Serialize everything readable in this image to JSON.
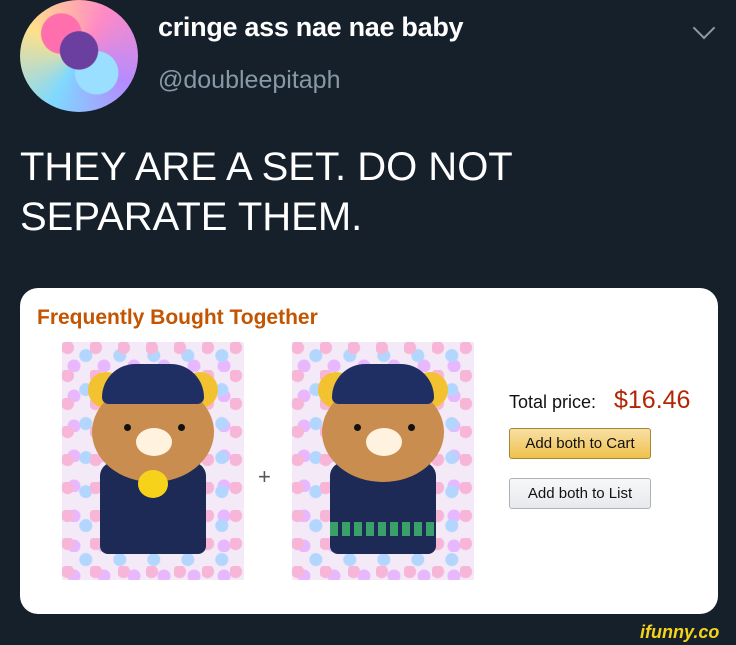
{
  "tweet": {
    "display_name": "cringe ass nae nae baby",
    "handle": "@doubleepitaph",
    "text": "THEY ARE A SET. DO NOT SEPARATE THEM."
  },
  "amazon_card": {
    "heading": "Frequently Bought Together",
    "plus": "+",
    "total_label": "Total price:",
    "total_price": "$16.46",
    "add_to_cart_label": "Add both to Cart",
    "add_to_list_label": "Add both to List"
  },
  "watermark": "ifunny.co",
  "colors": {
    "background": "#15202b",
    "amazon_heading": "#c45500",
    "price": "#b12704",
    "cart_button": "#f0c14b"
  }
}
